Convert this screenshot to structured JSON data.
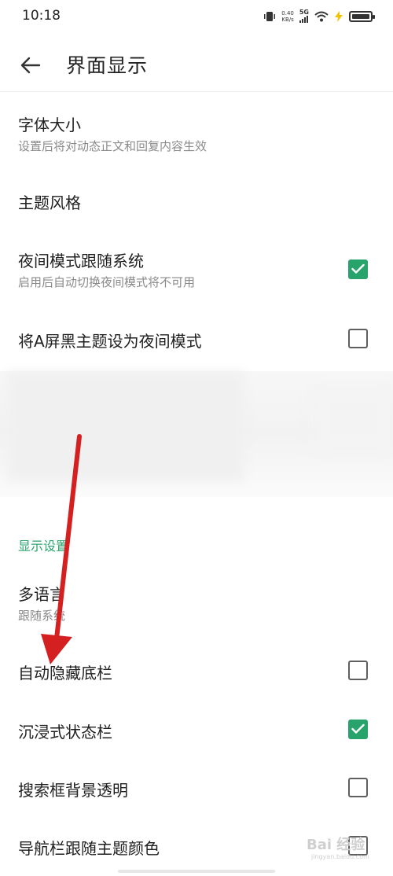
{
  "status_bar": {
    "time": "10:18",
    "net_speed_value": "0.40",
    "net_speed_unit": "KB/s",
    "network_type": "5G",
    "icons": [
      "vibrate-icon",
      "signal-icon",
      "wifi-icon",
      "charging-icon",
      "battery-icon"
    ]
  },
  "header": {
    "back_icon": "arrow-left-icon",
    "title": "界面显示"
  },
  "settings": {
    "font_size": {
      "title": "字体大小",
      "subtitle": "设置后将对动态正文和回复内容生效"
    },
    "theme_style": {
      "title": "主题风格"
    },
    "night_follow_system": {
      "title": "夜间模式跟随系统",
      "subtitle": "启用后自动切换夜间模式将不可用",
      "checked": true
    },
    "a_screen_black_night": {
      "title": "将A屏黑主题设为夜间模式",
      "checked": false
    }
  },
  "display_section": {
    "header": "显示设置",
    "multi_language": {
      "title": "多语言",
      "subtitle": "跟随系统"
    },
    "auto_hide_bottom_bar": {
      "title": "自动隐藏底栏",
      "checked": false
    },
    "immersive_status_bar": {
      "title": "沉浸式状态栏",
      "checked": true
    },
    "search_box_transparent": {
      "title": "搜索框背景透明",
      "checked": false
    },
    "nav_bar_follow_theme": {
      "title": "导航栏跟随主题颜色",
      "checked": false
    }
  },
  "colors": {
    "accent_green": "#27a36b",
    "annotation_red": "#d42020"
  },
  "watermark": {
    "text": "Bai 经验",
    "sub": "jingyan.baidu.com"
  }
}
